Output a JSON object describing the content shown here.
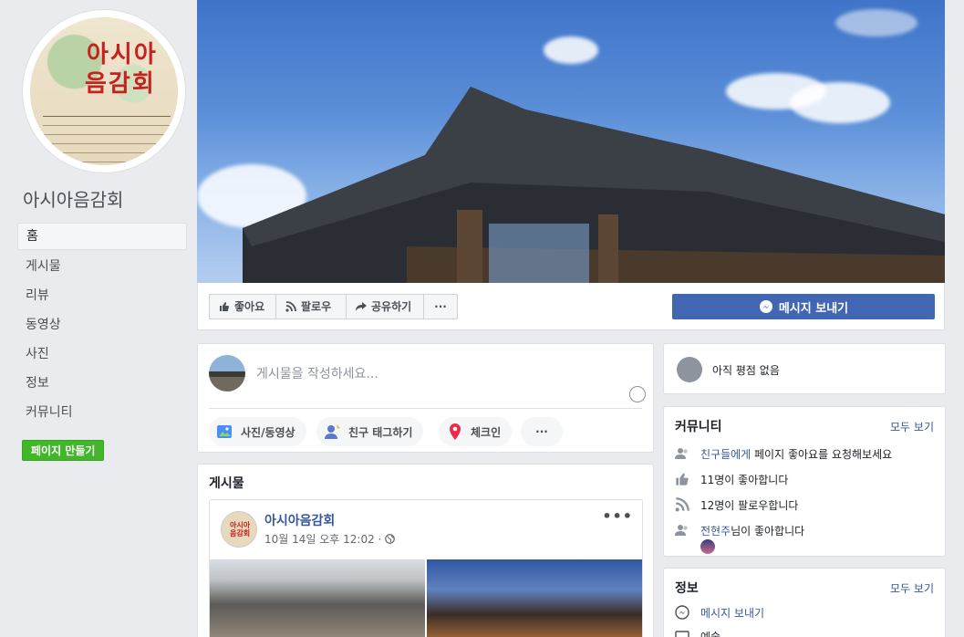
{
  "page": {
    "name": "아시아음감회",
    "avatar_text_line1": "아시아",
    "avatar_text_line2": "음감회"
  },
  "left_nav": {
    "items": [
      {
        "label": "홈"
      },
      {
        "label": "게시물"
      },
      {
        "label": "리뷰"
      },
      {
        "label": "동영상"
      },
      {
        "label": "사진"
      },
      {
        "label": "정보"
      },
      {
        "label": "커뮤니티"
      }
    ],
    "create_page_label": "페이지 만들기"
  },
  "actions": {
    "like_label": "좋아요",
    "follow_label": "팔로우",
    "share_label": "공유하기",
    "more_label": "···",
    "message_label": "메시지 보내기"
  },
  "composer": {
    "placeholder": "게시물을 작성하세요...",
    "photo_video_label": "사진/동영상",
    "tag_friends_label": "친구 태그하기",
    "checkin_label": "체크인",
    "more_label": "···"
  },
  "posts": {
    "title": "게시물",
    "post": {
      "author": "아시아음감회",
      "time": "10월 14일 오후 12:02 · ",
      "more_label": "•••"
    }
  },
  "reviews": {
    "text": "아직 평점 없음"
  },
  "community": {
    "title": "커뮤니티",
    "see_all": "모두 보기",
    "invite_highlight": "친구들에게",
    "invite_text": " 페이지 좋아요를 요청해보세요",
    "likes_text": "11명이 좋아합니다",
    "follows_text": "12명이 팔로우합니다",
    "friend_like_name": "전현주",
    "friend_like_text": "님이 좋아합니다"
  },
  "info": {
    "title": "정보",
    "see_all": "모두 보기",
    "message_label": "메시지 보내기",
    "partial_label": "예술"
  },
  "colors": {
    "brand_blue": "#4267b2",
    "link_blue": "#365899",
    "green": "#42b72a",
    "background": "#e9ebee"
  }
}
